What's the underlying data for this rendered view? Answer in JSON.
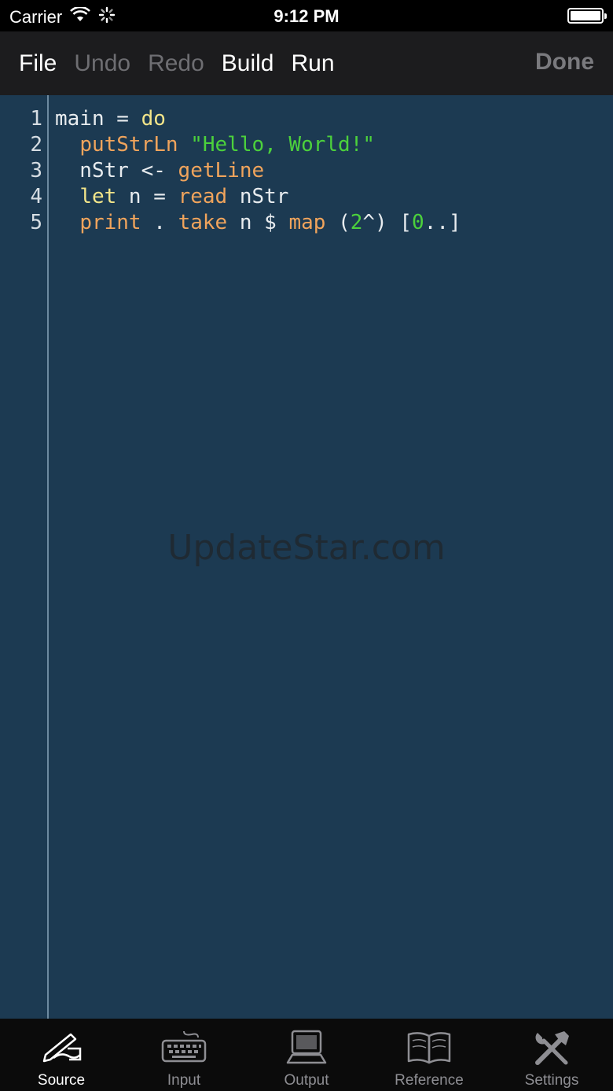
{
  "status": {
    "carrier": "Carrier",
    "time": "9:12 PM"
  },
  "toolbar": {
    "file": "File",
    "undo": "Undo",
    "redo": "Redo",
    "build": "Build",
    "run": "Run",
    "done": "Done"
  },
  "editor": {
    "line_numbers": [
      "1",
      "2",
      "3",
      "4",
      "5"
    ],
    "lines": [
      [
        [
          "main = ",
          "plain"
        ],
        [
          "do",
          "kw"
        ]
      ],
      [
        [
          "  ",
          "plain"
        ],
        [
          "putStrLn",
          "fn"
        ],
        [
          " ",
          "plain"
        ],
        [
          "\"Hello, World!\"",
          "str"
        ]
      ],
      [
        [
          "  nStr <- ",
          "plain"
        ],
        [
          "getLine",
          "fn"
        ]
      ],
      [
        [
          "  ",
          "plain"
        ],
        [
          "let",
          "kw"
        ],
        [
          " n = ",
          "plain"
        ],
        [
          "read",
          "fn"
        ],
        [
          " nStr",
          "plain"
        ]
      ],
      [
        [
          "  ",
          "plain"
        ],
        [
          "print",
          "fn"
        ],
        [
          " . ",
          "plain"
        ],
        [
          "take",
          "fn"
        ],
        [
          " n $ ",
          "plain"
        ],
        [
          "map",
          "fn"
        ],
        [
          " (",
          "plain"
        ],
        [
          "2",
          "num"
        ],
        [
          "^) [",
          "plain"
        ],
        [
          "0",
          "num"
        ],
        [
          "..]",
          "plain"
        ]
      ]
    ],
    "watermark": "UpdateStar.com"
  },
  "tabs": [
    {
      "label": "Source",
      "icon": "source-icon",
      "active": true
    },
    {
      "label": "Input",
      "icon": "keyboard-icon",
      "active": false
    },
    {
      "label": "Output",
      "icon": "computer-icon",
      "active": false
    },
    {
      "label": "Reference",
      "icon": "book-icon",
      "active": false
    },
    {
      "label": "Settings",
      "icon": "tools-icon",
      "active": false
    }
  ],
  "colors": {
    "editor_bg": "#1c3a52",
    "keyword": "#f2e58a",
    "function": "#f0a45c",
    "string": "#4cd13c"
  }
}
